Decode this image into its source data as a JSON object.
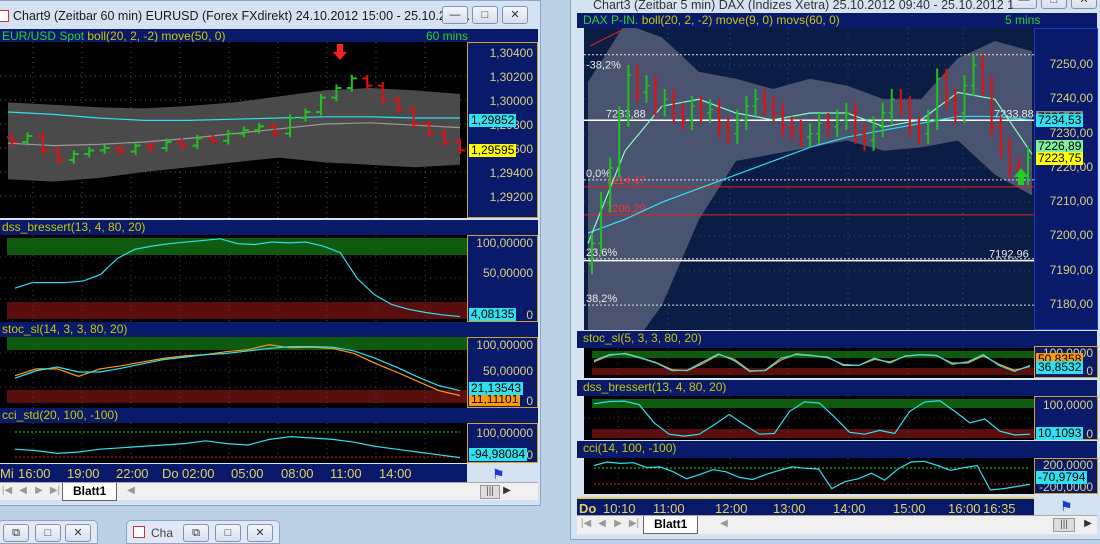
{
  "left_window": {
    "title": "Chart9 (Zeitbar 60 min)  EURUSD (Forex FXdirekt) 24.10.2012 15:00 - 25.10.201...",
    "header": {
      "instrument": "EUR/USD Spot",
      "indicators": "boll(20, 2, -2) move(50, 0)",
      "interval": "60 mins"
    },
    "price_axis": [
      "1,30400",
      "1,30200",
      "1,30000",
      "1,29800",
      "1,29600",
      "1,29400",
      "1,29200"
    ],
    "badges": {
      "move": "1,29852",
      "last": "1,29595"
    },
    "closes": [
      1.2965,
      1.297,
      1.2958,
      1.295,
      1.2955,
      1.2958,
      1.296,
      1.2957,
      1.2962,
      1.296,
      1.2965,
      1.2962,
      1.2968,
      1.2966,
      1.2972,
      1.2975,
      1.2978,
      1.2972,
      1.2985,
      1.299,
      1.3002,
      1.301,
      1.3018,
      1.3012,
      1.3,
      1.2992,
      1.298,
      1.2972,
      1.2965,
      1.2958
    ],
    "boll_upper": [
      1.2998,
      1.2996,
      1.2994,
      1.2993,
      1.2995,
      1.2998,
      1.3003,
      1.3008,
      1.301,
      1.3008,
      1.3005
    ],
    "boll_lower": [
      1.2934,
      1.2932,
      1.2935,
      1.294,
      1.2944,
      1.2948,
      1.2952,
      1.2948,
      1.2946,
      1.2944,
      1.2946
    ],
    "boll_mid": [
      1.2964,
      1.2962,
      1.2963,
      1.2965,
      1.2968,
      1.2972,
      1.2976,
      1.298,
      1.2981,
      1.2979,
      1.2977
    ],
    "move50": [
      1.299,
      1.2988,
      1.2985,
      1.2983,
      1.2983,
      1.2984,
      1.2985,
      1.2986,
      1.2986,
      1.2985,
      1.2985
    ],
    "dss": {
      "label": "dss_bressert(13, 4, 80, 20)",
      "axis": [
        "100,00000",
        "50,00000",
        "0"
      ],
      "badge": "4,08135",
      "values": [
        38,
        45,
        45,
        45,
        47,
        55,
        75,
        86,
        90,
        93,
        95,
        97,
        99,
        93,
        92,
        95,
        94,
        95,
        90,
        82,
        50,
        30,
        18,
        12,
        8,
        5,
        3
      ]
    },
    "stoc": {
      "label": "stoc_sl(14, 3, 3, 80, 20)",
      "axis": [
        "100,00000",
        "50,00000",
        "0"
      ],
      "badge": "21,13543",
      "badge2": "11,11101",
      "k": [
        40,
        52,
        58,
        50,
        50,
        56,
        63,
        70,
        74,
        78,
        80,
        84,
        88,
        91,
        91,
        90,
        84,
        72,
        58,
        42,
        28,
        20
      ],
      "d": [
        44,
        55,
        55,
        43,
        55,
        60,
        66,
        72,
        76,
        78,
        83,
        86,
        94,
        89,
        90,
        88,
        80,
        64,
        50,
        35,
        20,
        12
      ]
    },
    "cci": {
      "label": "cci_std(20, 100, -100)",
      "axis": [
        "100,00000",
        "0"
      ],
      "badge": "-94,98084",
      "values": [
        -30,
        -40,
        -60,
        -50,
        -30,
        -20,
        -10,
        0,
        10,
        30,
        10,
        0,
        40,
        60,
        50,
        40,
        20,
        -10,
        -30,
        -50,
        -70,
        -90
      ]
    },
    "time_axis": [
      "Mi",
      "16:00",
      "19:00",
      "22:00",
      "Do",
      "02:00",
      "05:00",
      "08:00",
      "11:00",
      "14:00"
    ],
    "sheet_tab": "Blatt1"
  },
  "right_window": {
    "title": "Chart3 (Zeitbar 5 min)  DAX (Indizes Xetra) 25.10.2012 09:40 - 25.10.2012 17:...",
    "header": {
      "instrument": "DAX P-IN.",
      "indicators": "boll(20, 2, -2) move(9, 0) movs(60, 0)",
      "interval": "5 mins"
    },
    "price_axis": [
      "7250,00",
      "7240,00",
      "7230,00",
      "7220,00",
      "7210,00",
      "7200,00",
      "7190,00",
      "7180,00"
    ],
    "badges": {
      "gray": "7235,03",
      "movs": "7234,53",
      "move": "7226,89",
      "last": "7223,75"
    },
    "levels": [
      {
        "label": "-38,2%",
        "value": 7253,
        "kind": "fib"
      },
      {
        "label": "7233,88",
        "value": 7233.88,
        "kind": "white"
      },
      {
        "label": "0,0%",
        "value": 7216.5,
        "kind": "fib"
      },
      {
        "label": "7214,47",
        "value": 7214.47,
        "kind": "red"
      },
      {
        "label": "7206,29",
        "value": 7206.29,
        "kind": "red"
      },
      {
        "label": "7192,96",
        "value": 7192.96,
        "kind": "white"
      },
      {
        "label": "23,6%",
        "value": 7193.5,
        "kind": "fib"
      },
      {
        "label": "38,2%",
        "value": 7180,
        "kind": "fib"
      }
    ],
    "closes": [
      7198,
      7210,
      7220,
      7235,
      7247,
      7242,
      7244,
      7238,
      7240,
      7236,
      7234,
      7238,
      7236,
      7237,
      7232,
      7230,
      7234,
      7238,
      7240,
      7238,
      7236,
      7232,
      7231,
      7229,
      7230,
      7233,
      7232,
      7234,
      7236,
      7230,
      7228,
      7232,
      7236,
      7240,
      7238,
      7232,
      7230,
      7234,
      7246,
      7240,
      7236,
      7244,
      7250,
      7244,
      7232,
      7226,
      7220,
      7218,
      7223
    ],
    "boll_upper": [
      7245,
      7262,
      7258,
      7248,
      7246,
      7243,
      7246,
      7244,
      7240,
      7240,
      7252,
      7257,
      7254
    ],
    "boll_lower": [
      7170,
      7165,
      7180,
      7205,
      7222,
      7224,
      7226,
      7228,
      7225,
      7226,
      7228,
      7218,
      7212
    ],
    "move9": [
      7198,
      7225,
      7238,
      7240,
      7236,
      7234,
      7236,
      7236,
      7232,
      7234,
      7242,
      7240,
      7224
    ],
    "movs60": [
      7201,
      7205,
      7210,
      7214,
      7218,
      7222,
      7226,
      7229,
      7231,
      7233,
      7235,
      7235,
      7234
    ],
    "stoc": {
      "label": "stoc_sl(5, 3, 3, 80, 20)",
      "axis": [
        "100,0000",
        "0"
      ],
      "badge": "36,8532",
      "badge2": "50,8358",
      "k": [
        60,
        85,
        88,
        70,
        50,
        18,
        20,
        55,
        88,
        60,
        15,
        20,
        70,
        85,
        80,
        75,
        40,
        40,
        70,
        50,
        80,
        85,
        82,
        45,
        55,
        85,
        40,
        15,
        40
      ],
      "d": [
        55,
        82,
        90,
        72,
        52,
        22,
        18,
        48,
        85,
        66,
        18,
        18,
        62,
        88,
        82,
        72,
        44,
        40,
        65,
        55,
        78,
        84,
        80,
        50,
        50,
        80,
        45,
        20,
        35
      ]
    },
    "dss": {
      "label": "dss_bressert(13, 4, 80, 20)",
      "axis": [
        "100,0000",
        "0"
      ],
      "badge": "10,1093",
      "values": [
        90,
        96,
        97,
        88,
        40,
        10,
        5,
        10,
        35,
        62,
        35,
        10,
        12,
        70,
        95,
        92,
        55,
        15,
        10,
        20,
        12,
        70,
        95,
        98,
        70,
        40,
        50,
        18,
        8,
        10
      ]
    },
    "cci": {
      "label": "cci(14, 100, -100)",
      "axis": [
        "200,0000",
        "-200,0000"
      ],
      "badge": "-70,9794",
      "values": [
        150,
        200,
        180,
        190,
        120,
        130,
        60,
        -40,
        20,
        90,
        60,
        -20,
        -50,
        20,
        80,
        130,
        110,
        100,
        -180,
        -80,
        -40,
        40,
        -60,
        100,
        200,
        210,
        150,
        80,
        120,
        150,
        -200,
        -180,
        -150,
        -120
      ]
    },
    "time_axis": [
      "Do",
      "10:10",
      "11:00",
      "12:00",
      "13:00",
      "14:00",
      "15:00",
      "16:00",
      "16:35"
    ],
    "sheet_tab": "Blatt1"
  },
  "taskbar": {
    "minimized_label": "Cha"
  },
  "colors": {
    "up": "#22c022",
    "down": "#e01010",
    "panel_bg": "#000000",
    "header_bg": "#0a1a6a",
    "cyan": "#30e0f0",
    "orange": "#ff9a10"
  }
}
